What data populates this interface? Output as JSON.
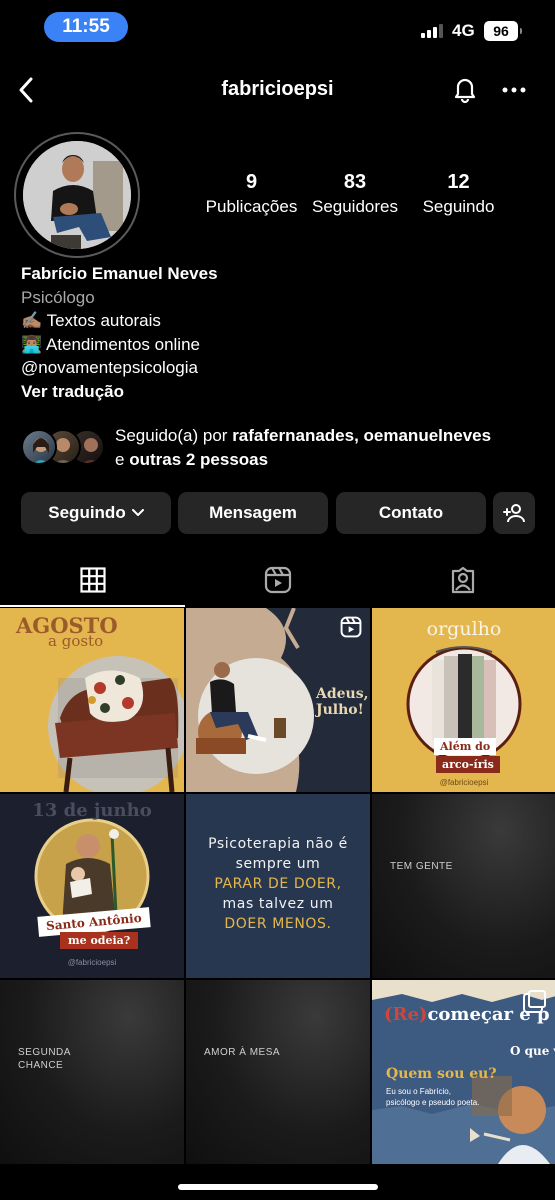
{
  "status_bar": {
    "time": "11:55",
    "network": "4G",
    "battery": "96"
  },
  "header": {
    "username": "fabricioepsi"
  },
  "profile": {
    "stats": [
      {
        "value": "9",
        "label": "Publicações"
      },
      {
        "value": "83",
        "label": "Seguidores"
      },
      {
        "value": "12",
        "label": "Seguindo"
      }
    ],
    "name": "Fabrício Emanuel Neves",
    "category": "Psicólogo",
    "bio_lines": [
      "✍🏽 Textos autorais",
      "👨🏽‍💻 Atendimentos online",
      "@novamentepsicologia"
    ],
    "translate": "Ver tradução"
  },
  "followed_by": {
    "prefix": "Seguido(a) por ",
    "names": "rafafernanades, oemanuelneves",
    "and": "e ",
    "others": "outras 2 pessoas"
  },
  "buttons": {
    "following": "Seguindo",
    "message": "Mensagem",
    "contact": "Contato"
  },
  "tabs": [
    "grid",
    "reels",
    "tagged"
  ],
  "posts": {
    "p1": {
      "title": "AGOSTO",
      "subtitle": "a gosto"
    },
    "p2": {
      "text": "Adeus, Julho!"
    },
    "p3": {
      "title": "orgulho",
      "label1": "Além do",
      "label2": "arco-íris",
      "handle": "@fabricioepsi"
    },
    "p4": {
      "title": "13 de junho",
      "label1": "Santo Antônio",
      "label2": "me odeia?",
      "handle": "@fabricioepsi"
    },
    "p5": {
      "line1": "Psicoterapia não é",
      "line2": "sempre um",
      "line3": "PARAR DE DOER,",
      "line4": "mas talvez um",
      "line5": "DOER MENOS."
    },
    "p6": {
      "caption": "TEM GENTE"
    },
    "p7": {
      "caption": "SEGUNDA\nCHANCE"
    },
    "p8": {
      "caption": "AMOR À MESA"
    },
    "p9": {
      "title_re": "(Re)",
      "title_rest": "começar é p",
      "question": "O que v",
      "who": "Quem sou eu?",
      "intro": "Eu sou o Fabrício, psicólogo e pseudo poeta."
    }
  },
  "colors": {
    "accent_blue": "#3a82f6",
    "button_bg": "#262626",
    "muted": "#a8a8a8"
  }
}
